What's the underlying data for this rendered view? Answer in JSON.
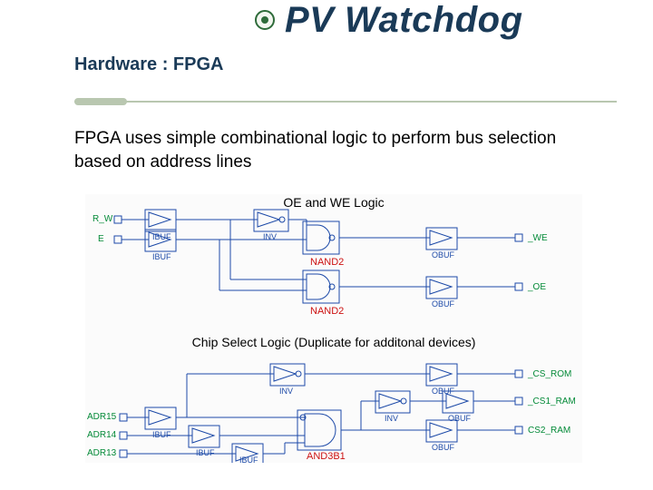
{
  "header": {
    "title": "PV Watchdog"
  },
  "subtitle": "Hardware : FPGA",
  "body": "FPGA uses simple combinational logic to perform bus selection based on address lines",
  "diagram": {
    "section1_title": "OE and WE Logic",
    "section2_title": "Chip Select Logic (Duplicate for additonal devices)",
    "buf_labels": {
      "ibuf": "IBUF",
      "obuf": "OBUF",
      "inv": "INV"
    },
    "gate_labels": {
      "nand2_a": "NAND2",
      "nand2_b": "NAND2",
      "and3b1": "AND3B1"
    },
    "signals": {
      "rw": "R_W",
      "e": "E",
      "we": "_WE",
      "oe": "_OE",
      "adr15": "ADR15",
      "adr14": "ADR14",
      "adr13": "ADR13",
      "cs_rom": "_CS_ROM",
      "cs1_ram": "_CS1_RAM",
      "cs2_ram": "CS2_RAM"
    }
  }
}
